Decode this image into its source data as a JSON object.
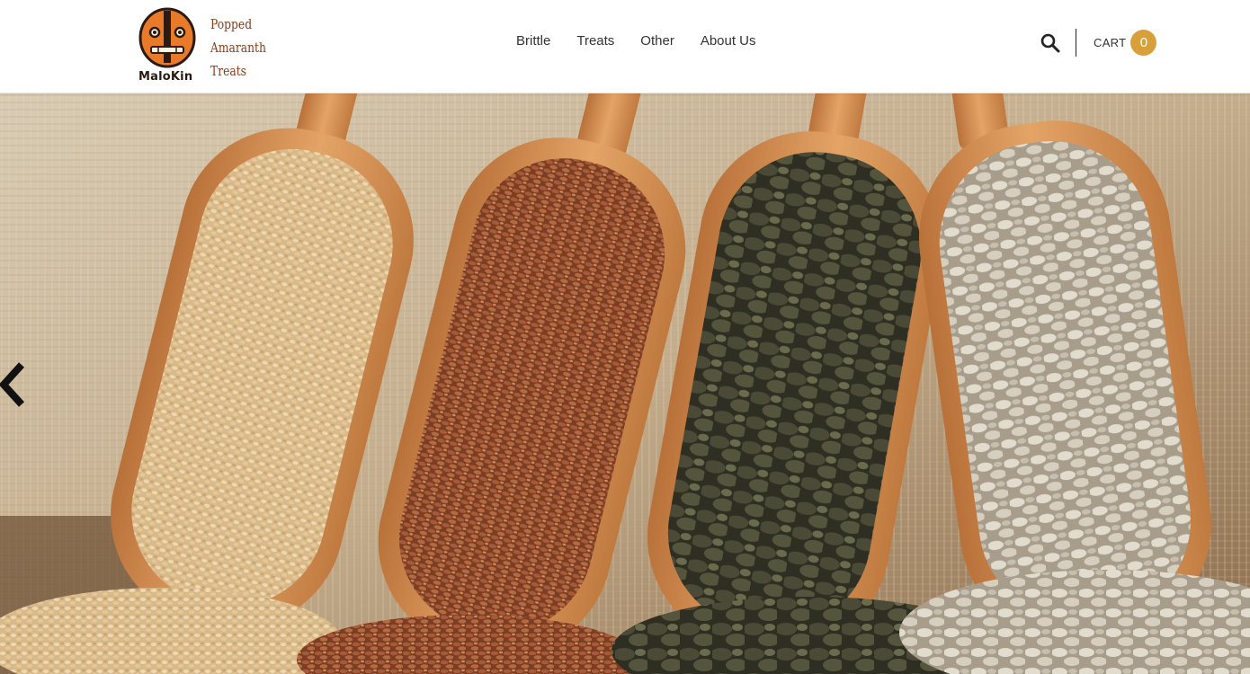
{
  "brand": {
    "name": "MaloKin",
    "tagline": [
      "Popped",
      "Amaranth",
      "Treats"
    ],
    "accent_color": "#d8a03a",
    "logo_orange": "#e97a2a",
    "logo_dark": "#2a1a10"
  },
  "nav": {
    "items": [
      {
        "label": "Brittle"
      },
      {
        "label": "Treats"
      },
      {
        "label": "Other"
      },
      {
        "label": "About Us"
      }
    ]
  },
  "header": {
    "search_icon": "search-icon",
    "cart_label": "CART",
    "cart_count": "0"
  },
  "hero": {
    "slider_prev_icon": "chevron-left-icon"
  }
}
